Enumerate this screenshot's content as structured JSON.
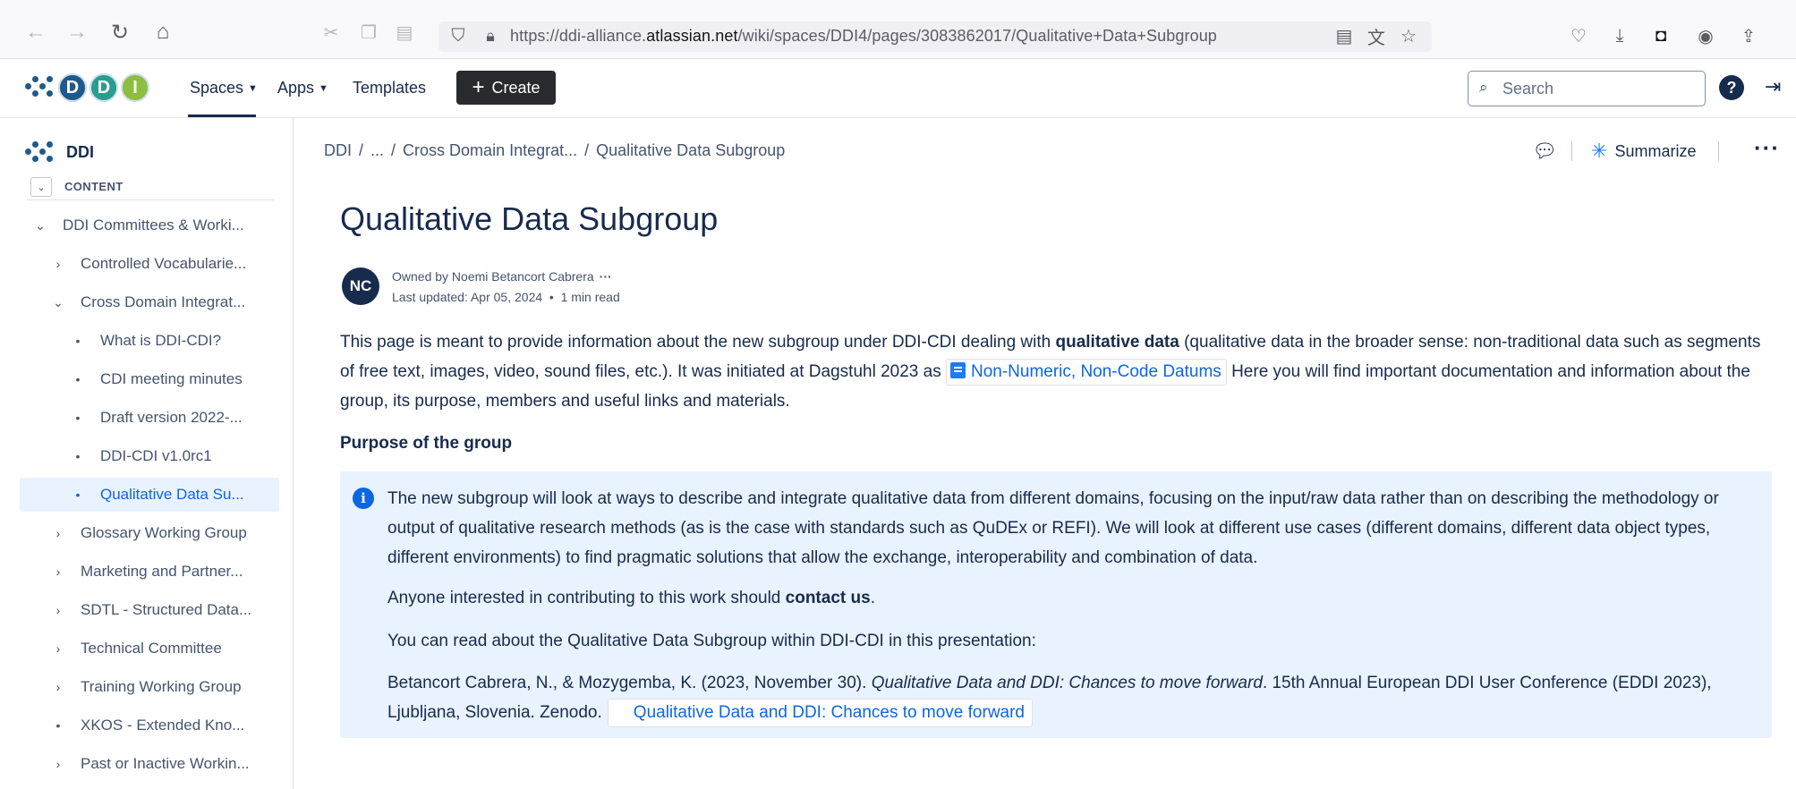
{
  "browser": {
    "url_prefix": "https://ddi-alliance.",
    "url_domain": "atlassian.net",
    "url_path": "/wiki/spaces/DDI4/pages/3083862017/Qualitative+Data+Subgroup"
  },
  "topnav": {
    "logo_letters": [
      "D",
      "D",
      "I"
    ],
    "spaces_label": "Spaces",
    "apps_label": "Apps",
    "templates_label": "Templates",
    "create_label": "Create",
    "search_placeholder": "Search"
  },
  "sidebar": {
    "space_name": "DDI",
    "content_label": "CONTENT",
    "items": [
      {
        "label": "DDI Committees & Worki...",
        "mark": "⌄"
      },
      {
        "label": "Controlled Vocabularie...",
        "mark": "›"
      },
      {
        "label": "Cross Domain Integrat...",
        "mark": "⌄"
      },
      {
        "label": "What is DDI-CDI?",
        "mark": "•"
      },
      {
        "label": "CDI meeting minutes",
        "mark": "•"
      },
      {
        "label": "Draft version 2022-...",
        "mark": "•"
      },
      {
        "label": "DDI-CDI v1.0rc1",
        "mark": "•"
      },
      {
        "label": "Qualitative Data Su...",
        "mark": "•"
      },
      {
        "label": "Glossary Working Group",
        "mark": "›"
      },
      {
        "label": "Marketing and Partner...",
        "mark": "›"
      },
      {
        "label": "SDTL - Structured Data...",
        "mark": "›"
      },
      {
        "label": "Technical Committee",
        "mark": "›"
      },
      {
        "label": "Training Working Group",
        "mark": "›"
      },
      {
        "label": "XKOS - Extended Kno...",
        "mark": "•"
      },
      {
        "label": "Past or Inactive Workin...",
        "mark": "›"
      }
    ]
  },
  "breadcrumb": {
    "root": "DDI",
    "sep": "/",
    "ellipsis": "...",
    "parent": "Cross Domain Integrat...",
    "current": "Qualitative Data Subgroup"
  },
  "page_actions": {
    "summarize_label": "Summarize"
  },
  "page": {
    "title": "Qualitative Data Subgroup",
    "owner_initials": "NC",
    "owned_by": "Owned by Noemi Betancort Cabrera",
    "last_updated": "Last updated: Apr 05, 2024",
    "read_time": "1 min read",
    "intro_part1": "This page is meant to provide information about the new subgroup under DDI-CDI dealing with ",
    "intro_bold": "qualitative data",
    "intro_part2": " (qualitative data in the broader sense: non-traditional data such as segments of free text, images, video, sound files, etc.). It was initiated at Dagstuhl 2023 as ",
    "intro_link": "Non-Numeric, Non-Code Datums",
    "intro_part3": " Here you will find important documentation and information about the group, its purpose, members and useful links and materials.",
    "purpose_heading": "Purpose of the group",
    "panel_p1": "The new subgroup will look at ways to describe and integrate qualitative data from different domains, focusing on the input/raw data rather than on describing the methodology or output of qualitative research methods (as is the case with standards such as QuDEx or REFI). We will look at different use cases (different domains, different data object types, different environments) to find pragmatic solutions that allow the exchange, interoperability and combination of data.",
    "panel_p2_pre": "Anyone interested in contributing to this work should ",
    "panel_p2_bold": "contact us",
    "panel_p2_post": ".",
    "panel_p3": "You can read about the Qualitative Data Subgroup within DDI-CDI in this presentation:",
    "ref_authors": "Betancort Cabrera, N., & Mozygemba, K. (2023, November 30). ",
    "ref_title_italic": "Qualitative Data and DDI: Chances to move forward",
    "ref_rest": ". 15th Annual European DDI User Conference (EDDI 2023), Ljubljana, Slovenia. Zenodo.",
    "ref_link": "Qualitative Data and DDI: Chances to move forward"
  }
}
